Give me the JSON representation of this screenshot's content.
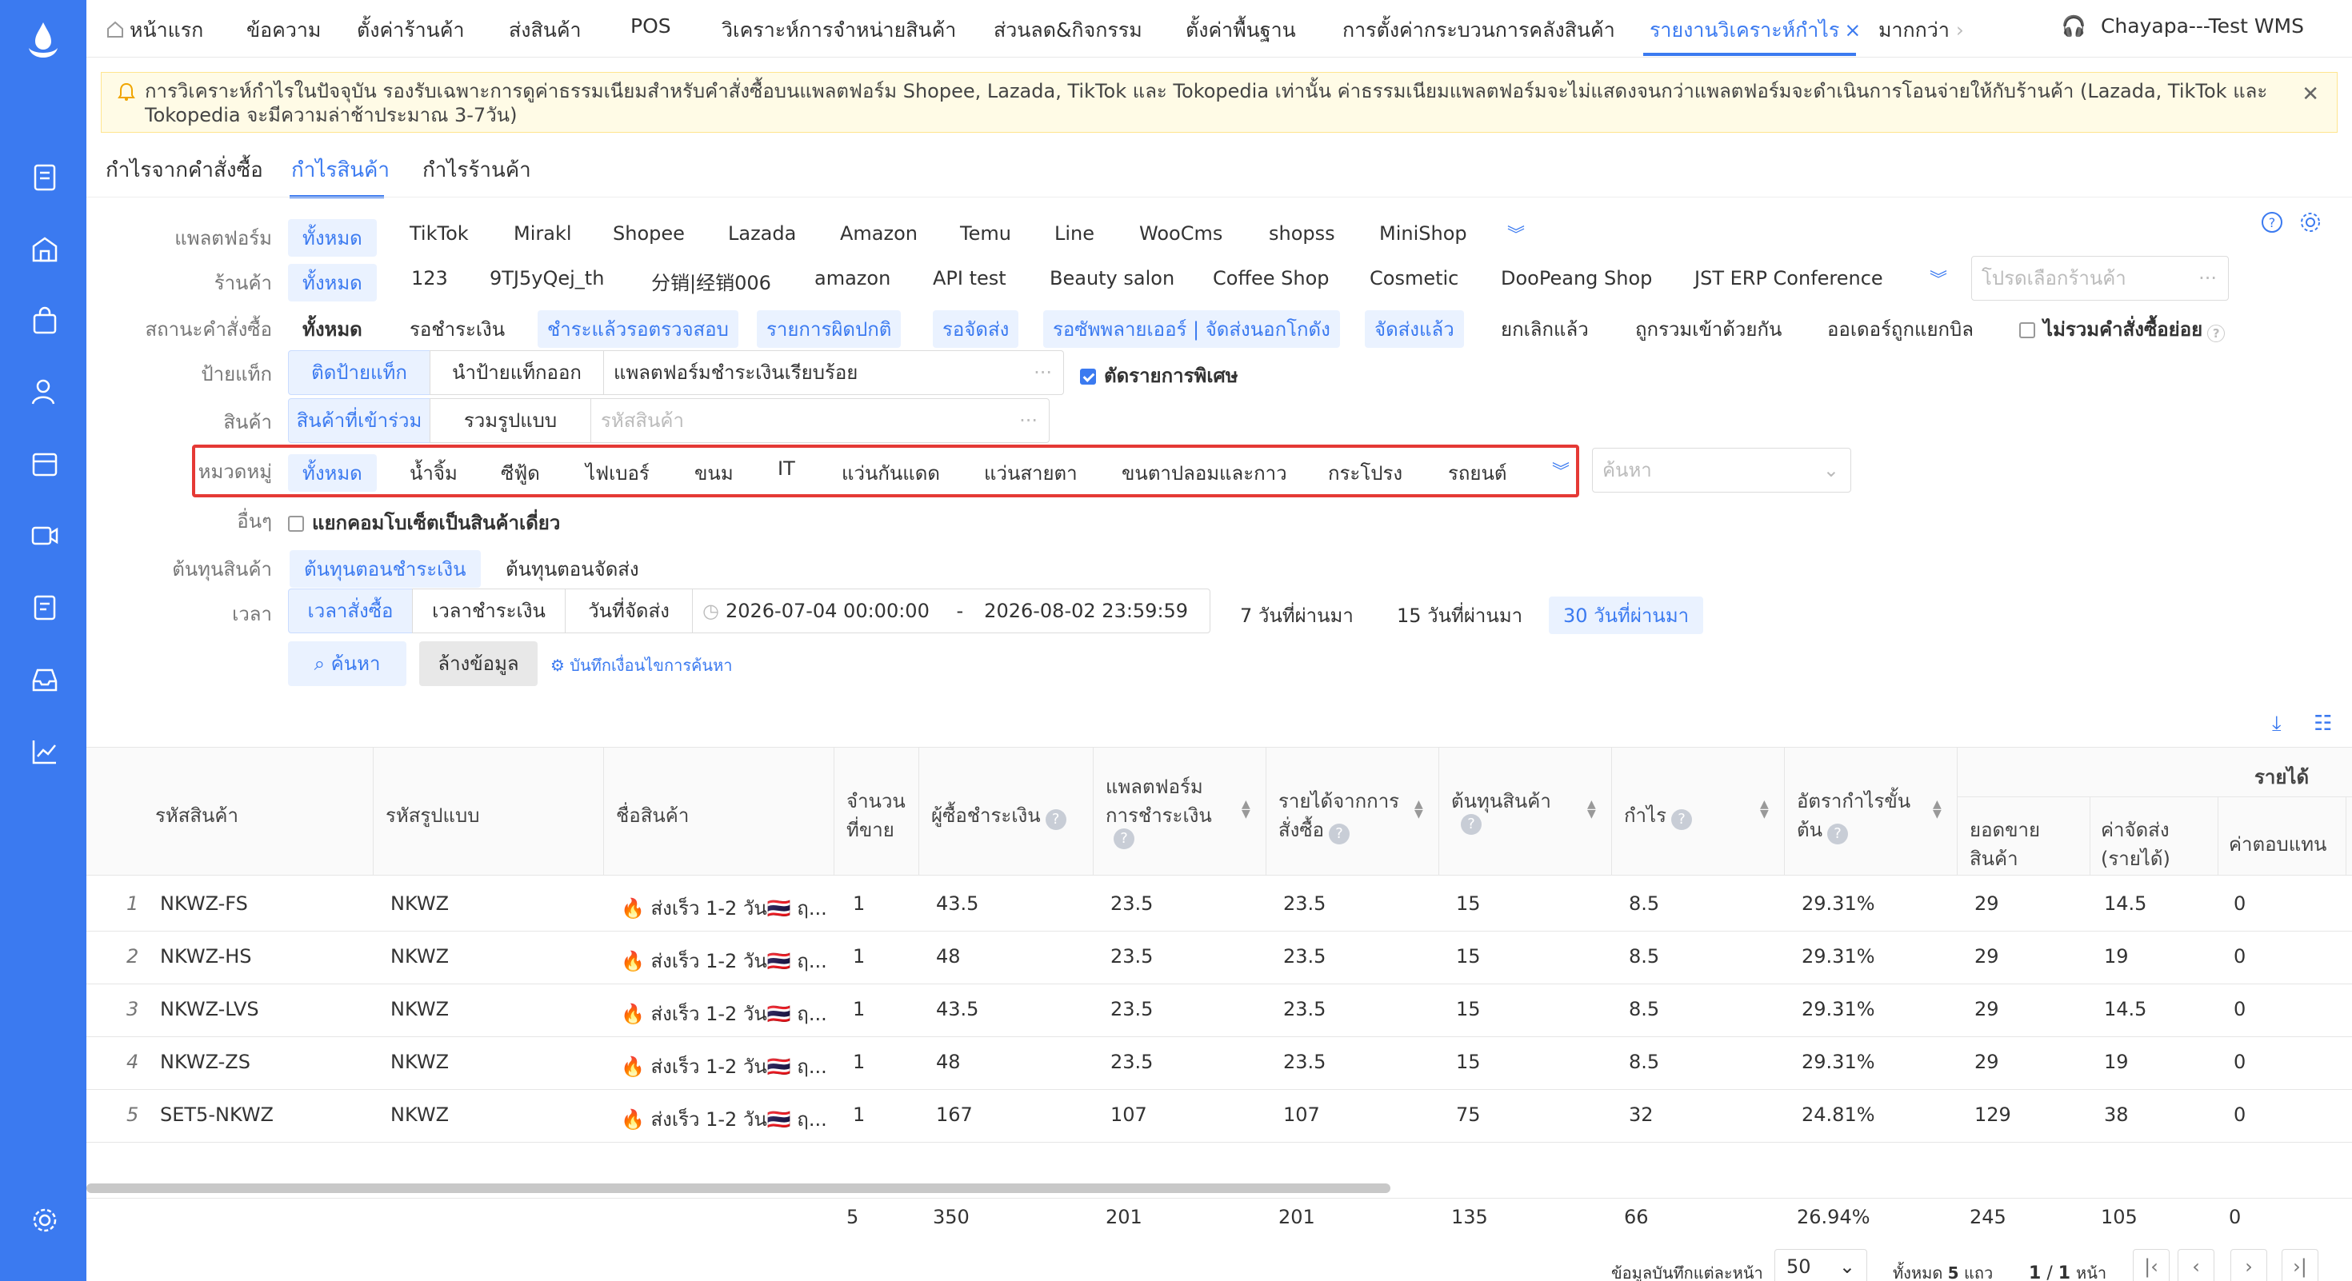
{
  "app": {
    "user": "Chayapa---Test WMS"
  },
  "topnav": {
    "items": [
      "หน้าแรก",
      "ข้อความ",
      "ตั้งค่าร้านค้า",
      "ส่งสินค้า",
      "POS",
      "วิเคราะห์การจำหน่ายสินค้า",
      "ส่วนลด&กิจกรรม",
      "ตั้งค่าพื้นฐาน",
      "การตั้งค่ากระบวนการคลังสินค้า",
      "รายงานวิเคราะห์กำไร",
      "มากกว่า"
    ],
    "active_index": 9
  },
  "notice": {
    "text": "การวิเคราะห์กำไรในปัจจุบัน รองรับเฉพาะการดูค่าธรรมเนียมสำหรับคำสั่งซื้อบนแพลตฟอร์ม Shopee, Lazada, TikTok และ Tokopedia เท่านั้น ค่าธรรมเนียมแพลตฟอร์มจะไม่แสดงจนกว่าแพลตฟอร์มจะดำเนินการโอนจ่ายให้กับร้านค้า (Lazada, TikTok และ Tokopedia จะมีความล่าช้าประมาณ 3-7วัน)"
  },
  "subtabs": {
    "items": [
      "กำไรจากคำสั่งซื้อ",
      "กำไรสินค้า",
      "กำไรร้านค้า"
    ],
    "active_index": 1
  },
  "filters": {
    "platform": {
      "label": "แพลตฟอร์ม",
      "options": [
        "ทั้งหมด",
        "TikTok",
        "Mirakl",
        "Shopee",
        "Lazada",
        "Amazon",
        "Temu",
        "Line",
        "WooCms",
        "shopss",
        "MiniShop"
      ]
    },
    "shop": {
      "label": "ร้านค้า",
      "options": [
        "ทั้งหมด",
        "123",
        "9TJ5yQej_th",
        "分销|经销006",
        "amazon",
        "API test",
        "Beauty salon",
        "Coffee Shop",
        "Cosmetic",
        "DooPeang Shop",
        "JST ERP Conference"
      ],
      "placeholder": "โปรดเลือกร้านค้า"
    },
    "order_status": {
      "label": "สถานะคำสั่งซื้อ",
      "options": [
        "ทั้งหมด",
        "รอชำระเงิน",
        "ชำระแล้วรอตรวจสอบ",
        "รายการผิดปกติ",
        "รอจัดส่ง",
        "รอซัพพลายเออร์ | จัดส่งนอกโกดัง",
        "จัดส่งแล้ว",
        "ยกเลิกแล้ว",
        "ถูกรวมเข้าด้วยกัน",
        "ออเดอร์ถูกแยกบิล"
      ],
      "exclude_sub": "ไม่รวมคำสั่งซื้อย่อย"
    },
    "tag": {
      "label": "ป้ายแท็ก",
      "seg1": "ติดป้ายแท็ก",
      "seg2": "นำป้ายแท็กออก",
      "value": "แพลตฟอร์มชำระเงินเรียบร้อย",
      "special": "ตัดรายการพิเศษ"
    },
    "product": {
      "label": "สินค้า",
      "seg1": "สินค้าที่เข้าร่วม",
      "seg2": "รวมรูปแบบ",
      "placeholder": "รหัสสินค้า"
    },
    "category": {
      "label": "หมวดหมู่",
      "options": [
        "ทั้งหมด",
        "น้ำจิ้ม",
        "ซีฟู้ด",
        "ไฟเบอร์",
        "ขนม",
        "IT",
        "แว่นกันแดด",
        "แว่นสายตา",
        "ขนตาปลอมและกาว",
        "กระโปรง",
        "รถยนต์"
      ],
      "search_placeholder": "ค้นหา"
    },
    "other": {
      "label": "อื่นๆ",
      "option": "แยกคอมโบเซ็ตเป็นสินค้าเดี่ยว"
    },
    "cost": {
      "label": "ต้นทุนสินค้า",
      "opt1": "ต้นทุนตอนชำระเงิน",
      "opt2": "ต้นทุนตอนจัดส่ง"
    },
    "time": {
      "label": "เวลา",
      "seg1": "เวลาสั่งซื้อ",
      "seg2": "เวลาชำระเงิน",
      "seg3": "วันที่จัดส่ง",
      "start": "2026-07-04 00:00:00",
      "sep": "-",
      "end": "2026-08-02 23:59:59",
      "quick": [
        "7 วันที่ผ่านมา",
        "15 วันที่ผ่านมา",
        "30 วันที่ผ่านมา"
      ]
    },
    "actions": {
      "search": "ค้นหา",
      "clear": "ล้างข้อมูล",
      "save": "บันทึกเงื่อนไขการค้นหา"
    }
  },
  "table": {
    "group_header": "รายได้",
    "headers": [
      "รหัสสินค้า",
      "รหัสรูปแบบ",
      "ชื่อสินค้า",
      "จำนวน",
      "ที่ขาย",
      "ผู้ซื้อชำระเงิน",
      "แพลตฟอร์ม",
      "การชำระเงิน",
      "รายได้จากการ",
      "สั่งซื้อ",
      "ต้นทุนสินค้า",
      "กำไร",
      "อัตรากำไรขั้น",
      "ต้น",
      "ยอดขาย",
      "สินค้า",
      "ค่าจัดส่ง",
      "(รายได้)",
      "ค่าตอบแทน"
    ],
    "rows": [
      {
        "no": "1",
        "sku": "NKWZ-FS",
        "style": "NKWZ",
        "name": "🔥 ส่งเร็ว 1-2 วัน🇹🇭 ฤ...",
        "qty": "1",
        "buyer_paid": "43.5",
        "platform_paid": "23.5",
        "order_income": "23.5",
        "cost": "15",
        "profit": "8.5",
        "margin": "29.31%",
        "sales": "29",
        "shipping": "14.5",
        "fee": "0"
      },
      {
        "no": "2",
        "sku": "NKWZ-HS",
        "style": "NKWZ",
        "name": "🔥 ส่งเร็ว 1-2 วัน🇹🇭 ฤ...",
        "qty": "1",
        "buyer_paid": "48",
        "platform_paid": "23.5",
        "order_income": "23.5",
        "cost": "15",
        "profit": "8.5",
        "margin": "29.31%",
        "sales": "29",
        "shipping": "19",
        "fee": "0"
      },
      {
        "no": "3",
        "sku": "NKWZ-LVS",
        "style": "NKWZ",
        "name": "🔥 ส่งเร็ว 1-2 วัน🇹🇭 ฤ...",
        "qty": "1",
        "buyer_paid": "43.5",
        "platform_paid": "23.5",
        "order_income": "23.5",
        "cost": "15",
        "profit": "8.5",
        "margin": "29.31%",
        "sales": "29",
        "shipping": "14.5",
        "fee": "0"
      },
      {
        "no": "4",
        "sku": "NKWZ-ZS",
        "style": "NKWZ",
        "name": "🔥 ส่งเร็ว 1-2 วัน🇹🇭 ฤ...",
        "qty": "1",
        "buyer_paid": "48",
        "platform_paid": "23.5",
        "order_income": "23.5",
        "cost": "15",
        "profit": "8.5",
        "margin": "29.31%",
        "sales": "29",
        "shipping": "19",
        "fee": "0"
      },
      {
        "no": "5",
        "sku": "SET5-NKWZ",
        "style": "NKWZ",
        "name": "🔥 ส่งเร็ว 1-2 วัน🇹🇭 ฤ...",
        "qty": "1",
        "buyer_paid": "167",
        "platform_paid": "107",
        "order_income": "107",
        "cost": "75",
        "profit": "32",
        "margin": "24.81%",
        "sales": "129",
        "shipping": "38",
        "fee": "0"
      }
    ],
    "totals": {
      "qty": "5",
      "buyer_paid": "350",
      "platform_paid": "201",
      "order_income": "201",
      "cost": "135",
      "profit": "66",
      "margin": "26.94%",
      "sales": "245",
      "shipping": "105",
      "fee": "0"
    }
  },
  "pager": {
    "per_page_label": "ข้อมูลบันทึกแต่ละหน้า",
    "per_page": "50",
    "total_prefix": "ทั้งหมด",
    "total": "5",
    "total_suffix": "แถว",
    "page": "1",
    "sep": "/",
    "pages": "1",
    "page_suffix": "หน้า"
  },
  "colors": {
    "primary": "#3b7af0",
    "sidebar": "#3b7af0",
    "notice_bg": "#fffbe6",
    "highlight_border": "#e53935"
  }
}
